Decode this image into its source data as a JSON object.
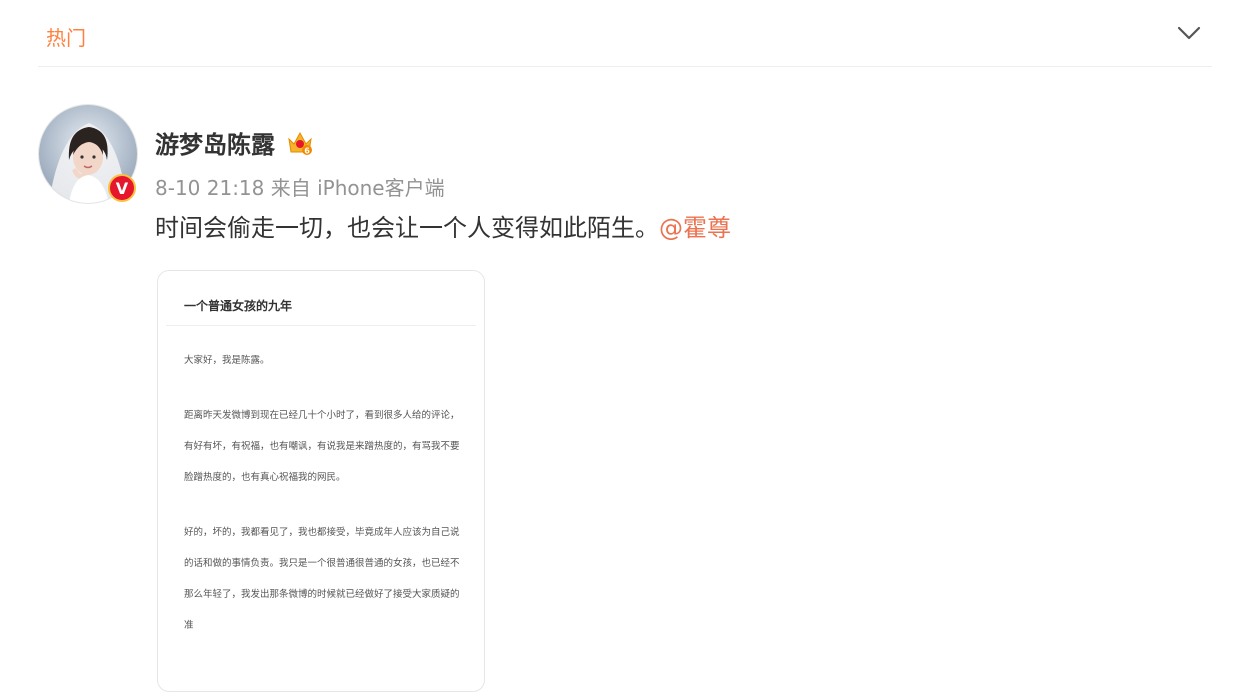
{
  "header": {
    "tab_label": "热门",
    "collapse_icon": "chevron-down-icon"
  },
  "post": {
    "author": {
      "name": "游梦岛陈露",
      "badge_icon": "crown-vip-icon",
      "verified_icon": "verified-v-icon",
      "verified_letter": "V"
    },
    "time": "8-10 21:18",
    "source": "来自 iPhone客户端",
    "text": "时间会偷走一切，也会让一个人变得如此陌生。",
    "mention": "@霍尊",
    "image": {
      "title": "一个普通女孩的九年",
      "paragraphs": [
        "大家好，我是陈露。",
        "距离昨天发微博到现在已经几十个小时了，看到很多人给的评论，有好有坏，有祝福，也有嘲讽，有说我是来蹭热度的，有骂我不要脸蹭热度的，也有真心祝福我的网民。",
        "好的，坏的，我都看见了，我也都接受，毕竟成年人应该为自己说的话和做的事情负责。我只是一个很普通很普通的女孩，也已经不那么年轻了，我发出那条微博的时候就已经做好了接受大家质疑的准"
      ]
    }
  },
  "colors": {
    "accent": "#ff8140",
    "mention": "#eb7350",
    "meta": "#939393",
    "verified": "#e6162d"
  }
}
